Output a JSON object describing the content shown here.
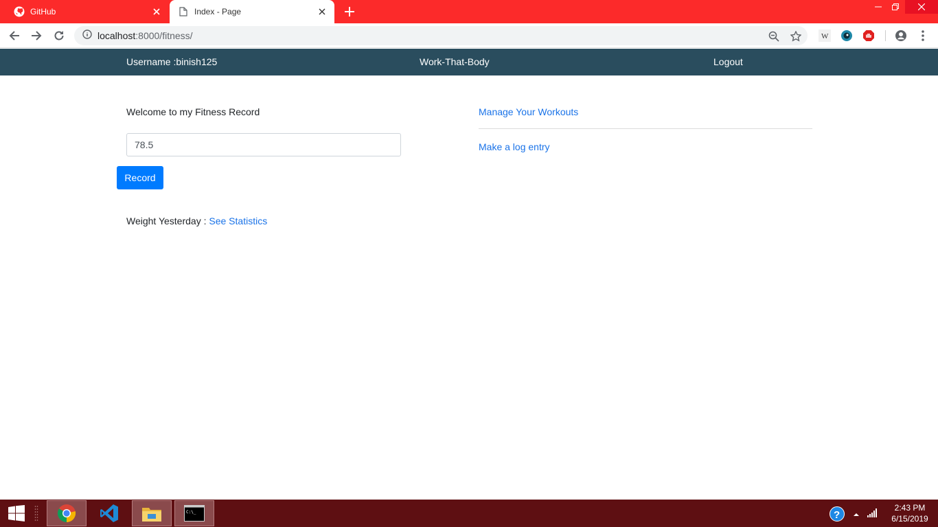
{
  "browser": {
    "tabs": [
      {
        "title": "GitHub",
        "icon": "github-icon"
      },
      {
        "title": "Index - Page",
        "icon": "page-icon"
      }
    ],
    "url": {
      "host": "localhost",
      "path": ":8000/fitness/"
    },
    "colors": {
      "tabstrip": "#fc2a2a",
      "close_hover": "#e81123"
    }
  },
  "site": {
    "nav": {
      "username": "Username :binish125",
      "brand": "Work-That-Body",
      "logout": "Logout"
    },
    "colors": {
      "navbar": "#2a4d5e",
      "primary": "#007bff",
      "link": "#1a73e8"
    }
  },
  "main": {
    "welcome": "Welcome to my Fitness Record",
    "weight_value": "78.5",
    "record_label": "Record",
    "weight_yesterday_label": "Weight Yesterday :",
    "see_statistics": "See Statistics",
    "manage_workouts": "Manage Your Workouts",
    "log_entry": "Make a log entry"
  },
  "taskbar": {
    "apps": [
      "chrome-icon",
      "vscode-icon",
      "file-explorer-icon",
      "command-prompt-icon"
    ],
    "time": "2:43 PM",
    "date": "6/15/2019",
    "color": "#5e0f12"
  }
}
